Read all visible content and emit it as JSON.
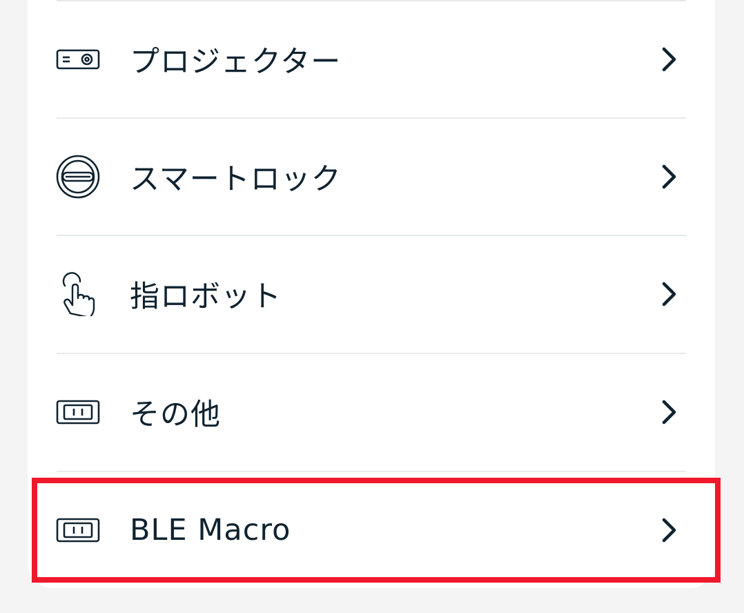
{
  "device_categories": [
    {
      "label": "プロジェクター",
      "icon": "projector-icon"
    },
    {
      "label": "スマートロック",
      "icon": "smart-lock-icon"
    },
    {
      "label": "指ロボット",
      "icon": "finger-robot-icon"
    },
    {
      "label": "その他",
      "icon": "plug-icon"
    },
    {
      "label": "BLE Macro",
      "icon": "plug-icon"
    }
  ],
  "colors": {
    "text": "#0f2230",
    "highlight": "#f0192b",
    "divider": "#e6e9ea",
    "background": "#f4f4f4",
    "card": "#ffffff"
  }
}
